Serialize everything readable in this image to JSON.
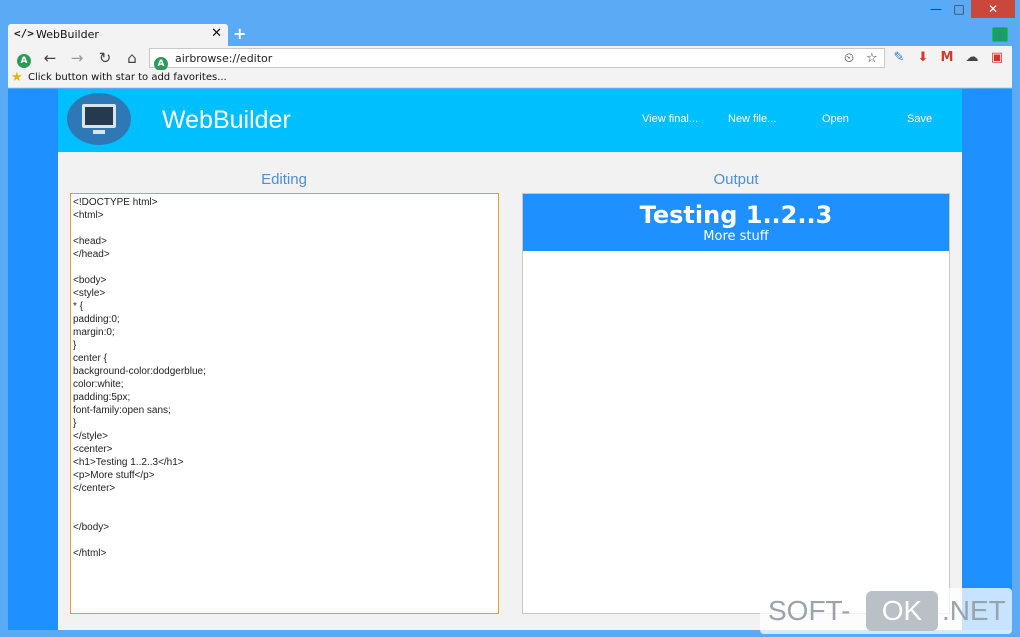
{
  "window": {
    "min_label": "—",
    "max_label": "□",
    "close_label": "✕"
  },
  "tab": {
    "icon": "</>",
    "title": "WebBuilder",
    "close": "✕",
    "new_tab": "+"
  },
  "toolbar": {
    "logo_letter": "A",
    "back": "←",
    "forward": "→",
    "reload": "↻",
    "home": "⌂",
    "address_icon": "A",
    "url": "airbrowse://editor",
    "clock_icon": "⏲",
    "star": "☆"
  },
  "favorites": {
    "star": "★",
    "text": "Click button with star to add favorites..."
  },
  "app": {
    "title": "WebBuilder",
    "nav": {
      "view": "View final...",
      "new": "New file...",
      "open": "Open",
      "save": "Save"
    },
    "editing_label": "Editing",
    "output_label": "Output",
    "code": "<!DOCTYPE html>\n<html>\n\n<head>\n</head>\n\n<body>\n<style>\n* {\npadding:0;\nmargin:0;\n}\ncenter {\nbackground-color:dodgerblue;\ncolor:white;\npadding:5px;\nfont-family:open sans;\n}\n</style>\n<center>\n<h1>Testing 1..2..3</h1>\n<p>More stuff</p>\n</center>\n\n\n</body>\n\n</html>",
    "output": {
      "heading": "Testing 1..2..3",
      "paragraph": "More stuff"
    }
  },
  "watermark": {
    "part1": "SOFT-",
    "part2": "OK",
    "part3": ".NET"
  }
}
